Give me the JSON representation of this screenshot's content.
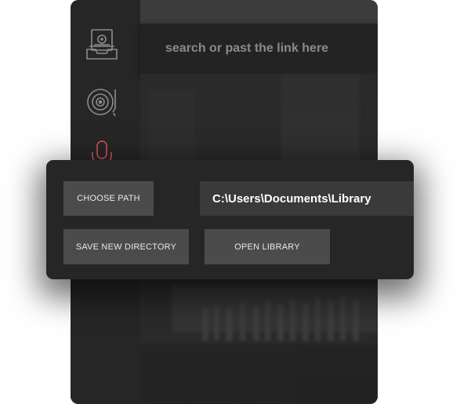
{
  "search": {
    "placeholder": "search or past the link here"
  },
  "sidebar": {
    "items": [
      {
        "icon": "inbox-tray-icon",
        "label": ""
      },
      {
        "icon": "turntable-icon",
        "label": ""
      },
      {
        "icon": "microphone-icon",
        "label": ""
      }
    ],
    "accent": "#c0504d"
  },
  "library_panel": {
    "choose_path_label": "CHOOSE PATH",
    "path_value": "C:\\Users\\Documents\\Library",
    "save_directory_label": "SAVE NEW DIRECTORY",
    "open_library_label": "OPEN LIBRARY"
  },
  "colors": {
    "app_bg": "#2a2a2a",
    "panel_bg": "#262626",
    "button_bg": "#4b4b4b",
    "mic_accent": "#c0504d"
  }
}
